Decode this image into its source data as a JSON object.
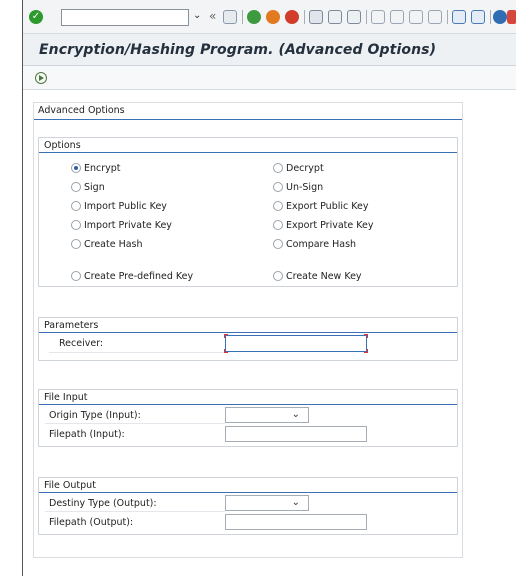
{
  "window": {
    "title": "Encryption/Hashing Program. (Advanced Options)"
  },
  "toolbar": {
    "command_field_value": "",
    "icons": [
      "enter-icon",
      "save-icon",
      "back-icon",
      "exit-icon",
      "cancel-icon",
      "print-icon",
      "find-icon",
      "find-next-icon",
      "first-page-icon",
      "previous-page-icon",
      "next-page-icon",
      "last-page-icon",
      "create-session-icon",
      "shortcut-icon",
      "help-icon",
      "customize-layout-icon"
    ],
    "colors": {
      "enter": "#2e9a2e",
      "nav_green": "#3f9a3f",
      "nav_orange": "#e27a1f",
      "cancel_red": "#d23c2a",
      "help_blue": "#2f6db5"
    }
  },
  "main": {
    "title": "Advanced Options",
    "options": {
      "title": "Options",
      "radios": [
        {
          "label": "Encrypt",
          "selected": true
        },
        {
          "label": "Decrypt",
          "selected": false
        },
        {
          "label": "Sign",
          "selected": false
        },
        {
          "label": "Un-Sign",
          "selected": false
        },
        {
          "label": "Import Public Key",
          "selected": false
        },
        {
          "label": "Export Public Key",
          "selected": false
        },
        {
          "label": "Import Private Key",
          "selected": false
        },
        {
          "label": "Export Private Key",
          "selected": false
        },
        {
          "label": "Create Hash",
          "selected": false
        },
        {
          "label": "Compare Hash",
          "selected": false
        },
        {
          "label": "Create Pre-defined Key",
          "selected": false
        },
        {
          "label": "Create New Key",
          "selected": false
        }
      ]
    },
    "parameters": {
      "title": "Parameters",
      "receiver_label": "Receiver:",
      "receiver_value": ""
    },
    "file_input": {
      "title": "File Input",
      "origin_type_label": "Origin Type (Input):",
      "origin_type_value": "",
      "filepath_label": "Filepath (Input):",
      "filepath_value": ""
    },
    "file_output": {
      "title": "File Output",
      "destiny_type_label": "Destiny Type (Output):",
      "destiny_type_value": "",
      "filepath_label": "Filepath (Output):",
      "filepath_value": ""
    }
  }
}
